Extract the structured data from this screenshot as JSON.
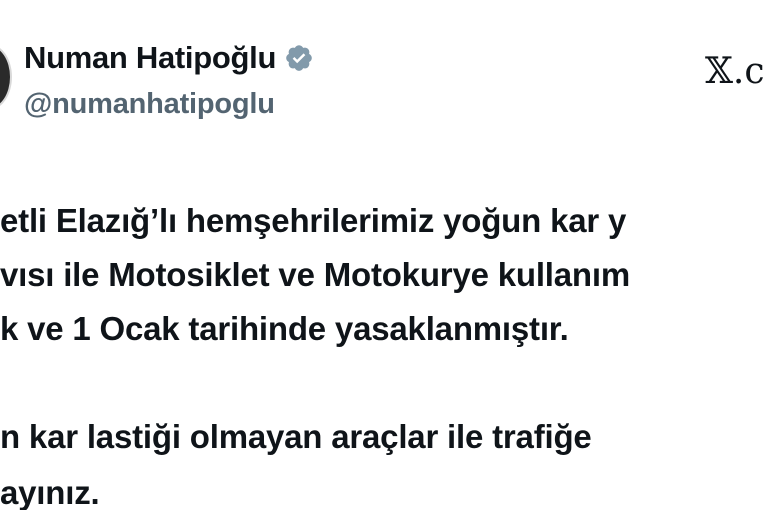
{
  "author": {
    "display_name": "Numan Hatipoğlu",
    "handle": "@numanhatipoglu",
    "verified": true
  },
  "branding": {
    "logo_text": "𝕏.c"
  },
  "tweet": {
    "lines": [
      "etli Elazığ’lı hemşehrilerimiz yoğun kar y",
      "vısı ile Motosiklet ve Motokurye kullanım",
      "k ve 1 Ocak tarihinde yasaklanmıştır.",
      "n kar lastiği olmayan araçlar ile trafiğe",
      "ayınız."
    ]
  },
  "colors": {
    "text": "#0f1419",
    "handle": "#536471",
    "badge": "#829aab"
  },
  "icons": {
    "verified": "verified-badge-icon",
    "brand": "x-logo-icon"
  }
}
